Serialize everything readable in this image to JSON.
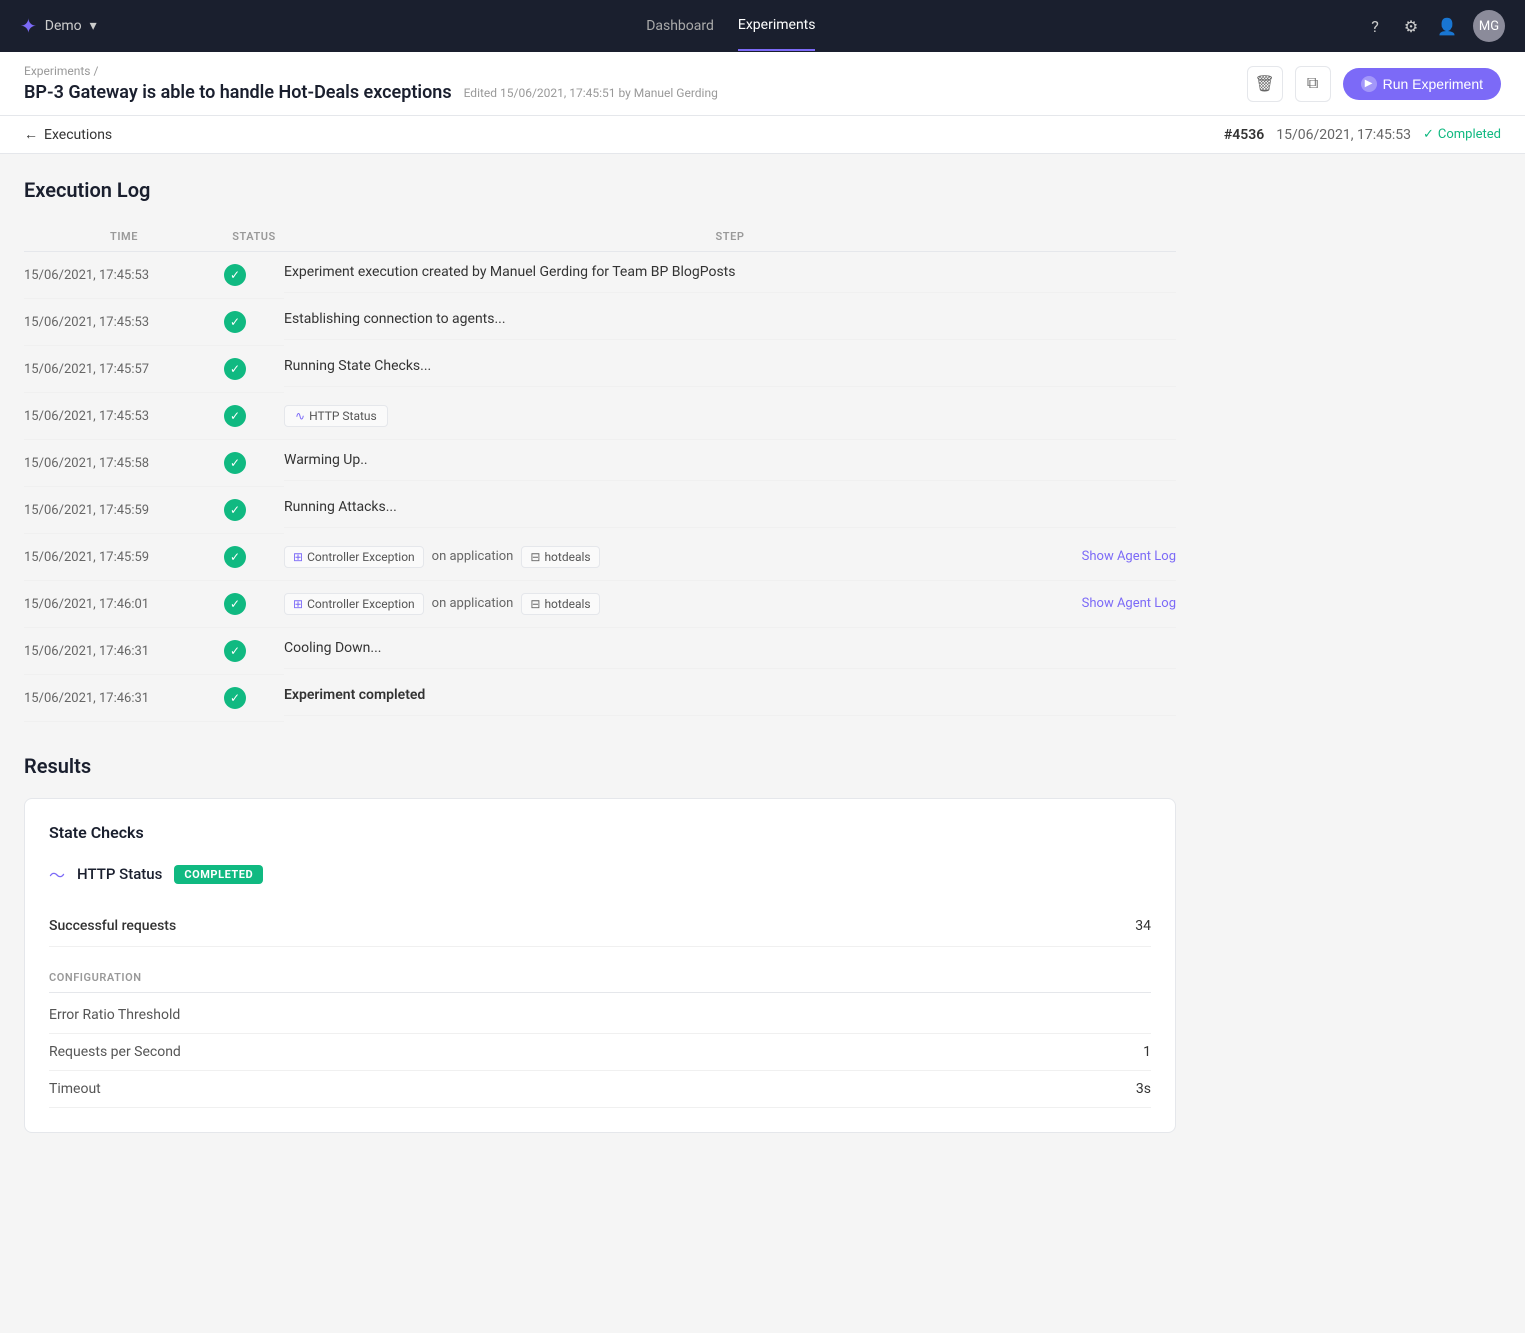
{
  "nav": {
    "logo": "✦",
    "workspace": "Demo",
    "links": [
      "Dashboard",
      "Experiments"
    ],
    "active_link": "Experiments",
    "icons": [
      "?",
      "⚙",
      "👤"
    ],
    "avatar_initials": "MG"
  },
  "breadcrumb": {
    "parent": "Experiments",
    "separator": "/"
  },
  "page_header": {
    "title": "BP-3 Gateway is able to handle Hot-Deals exceptions",
    "meta": "Edited 15/06/2021, 17:45:51 by Manuel Gerding",
    "run_button": "Run Experiment"
  },
  "executions": {
    "back_label": "Executions",
    "exec_id": "#4536",
    "exec_date": "15/06/2021, 17:45:53",
    "status": "Completed"
  },
  "execution_log": {
    "title": "Execution Log",
    "columns": {
      "time": "TIME",
      "status": "STATUS",
      "step": "STEP"
    },
    "rows": [
      {
        "time": "15/06/2021, 17:45:53",
        "status": "success",
        "step_text": "Experiment execution created by Manuel Gerding for Team BP BlogPosts",
        "step_type": "text"
      },
      {
        "time": "15/06/2021, 17:45:53",
        "status": "success",
        "step_text": "Establishing connection to agents...",
        "step_type": "text"
      },
      {
        "time": "15/06/2021, 17:45:57",
        "status": "success",
        "step_text": "Running State Checks...",
        "step_type": "text"
      },
      {
        "time": "15/06/2021, 17:45:53",
        "status": "success",
        "step_text": "HTTP Status",
        "step_type": "tag_http"
      },
      {
        "time": "15/06/2021, 17:45:58",
        "status": "success",
        "step_text": "Warming Up..",
        "step_type": "text"
      },
      {
        "time": "15/06/2021, 17:45:59",
        "status": "success",
        "step_text": "Running Attacks...",
        "step_type": "text"
      },
      {
        "time": "15/06/2021, 17:45:59",
        "status": "success",
        "step_text": "Controller Exception",
        "step_type": "attack",
        "on_app": "on application",
        "app_name": "hotdeals",
        "show_agent_log": "Show Agent Log"
      },
      {
        "time": "15/06/2021, 17:46:01",
        "status": "success",
        "step_text": "Controller Exception",
        "step_type": "attack",
        "on_app": "on application",
        "app_name": "hotdeals",
        "show_agent_log": "Show Agent Log"
      },
      {
        "time": "15/06/2021, 17:46:31",
        "status": "success",
        "step_text": "Cooling Down...",
        "step_type": "text"
      },
      {
        "time": "15/06/2021, 17:46:31",
        "status": "success",
        "step_text": "Experiment completed",
        "step_type": "bold"
      }
    ]
  },
  "results": {
    "title": "Results",
    "card": {
      "state_checks_title": "State Checks",
      "http_status_label": "HTTP Status",
      "completed_badge": "COMPLETED",
      "successful_requests_label": "Successful requests",
      "successful_requests_value": "34",
      "config_header": "CONFIGURATION",
      "config_rows": [
        {
          "label": "Error Ratio Threshold",
          "value": ""
        },
        {
          "label": "Requests per Second",
          "value": "1"
        },
        {
          "label": "Timeout",
          "value": "3s"
        }
      ]
    }
  }
}
